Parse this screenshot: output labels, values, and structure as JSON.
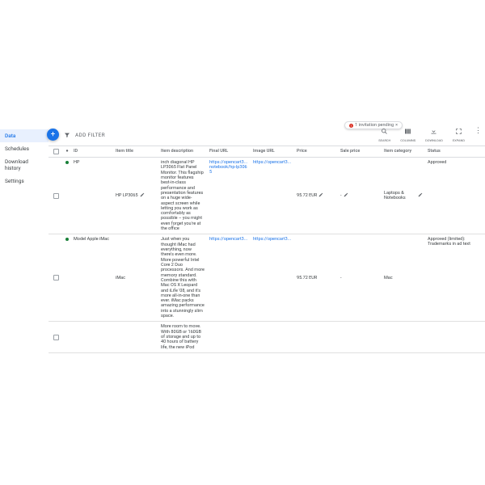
{
  "sidebar": {
    "items": [
      {
        "label": "Data",
        "active": true
      },
      {
        "label": "Schedules",
        "active": false
      },
      {
        "label": "Download history",
        "active": false
      },
      {
        "label": "Settings",
        "active": false
      }
    ]
  },
  "toolbar": {
    "add_filter": "ADD FILTER"
  },
  "right_tools": {
    "search": "SEARCH",
    "columns": "COLUMNS",
    "download": "DOWNLOAD",
    "expand": "EXPAND",
    "more": "MORE"
  },
  "badge": {
    "count": "1",
    "text": "1 invitation pending"
  },
  "columns": {
    "id": "ID",
    "item_title": "Item title",
    "item_description": "Item description",
    "final_url": "Final URL",
    "image_url": "Image URL",
    "price": "Price",
    "sale_price": "Sale price",
    "item_category": "Item category",
    "status": "Status"
  },
  "rows": [
    {
      "id": "HP",
      "title": "HP LP3065",
      "title_editable": true,
      "description": "inch diagonal HP LP3065 Flat Panel Monitor. This flagship monitor features best-in-class performance and presentation features on a huge wide-aspect screen while letting you work as comfortably as possible – you might even forget you're at the office",
      "final_url": "https://opencart3... notebook/hp-lp3065",
      "image_url": "https://opencart3...",
      "price": "95.72 EUR",
      "price_editable": true,
      "sale_price": "-",
      "sale_price_editable": true,
      "category": "Laptops &amp; Notebooks",
      "category_editable": true,
      "status": "Approved"
    },
    {
      "id": "Model Apple iMac",
      "title": "iMac",
      "title_editable": false,
      "description": "Just when you thought iMac had everything, now there's even more. More powerful Intel Core 2 Duo processors. And more memory standard. Combine this with Mac OS X Leopard and iLife '08, and it's more all-in-one than ever. iMac packs amazing performance into a stunningly slim space.",
      "final_url": "https://opencart3...",
      "image_url": "https://opencart3...",
      "price": "95.72 EUR",
      "price_editable": false,
      "sale_price": "-",
      "sale_price_editable": false,
      "category": "Mac",
      "category_editable": false,
      "status": "Approved (limited): Trademarks in ad text"
    },
    {
      "id": "",
      "title": "",
      "title_editable": false,
      "description": "More room to move. With 80GB or 160GB of storage and up to 40 hours of battery life, the new iPod",
      "final_url": "",
      "image_url": "",
      "price": "",
      "price_editable": false,
      "sale_price": "",
      "sale_price_editable": false,
      "category": "",
      "category_editable": false,
      "status": ""
    }
  ]
}
